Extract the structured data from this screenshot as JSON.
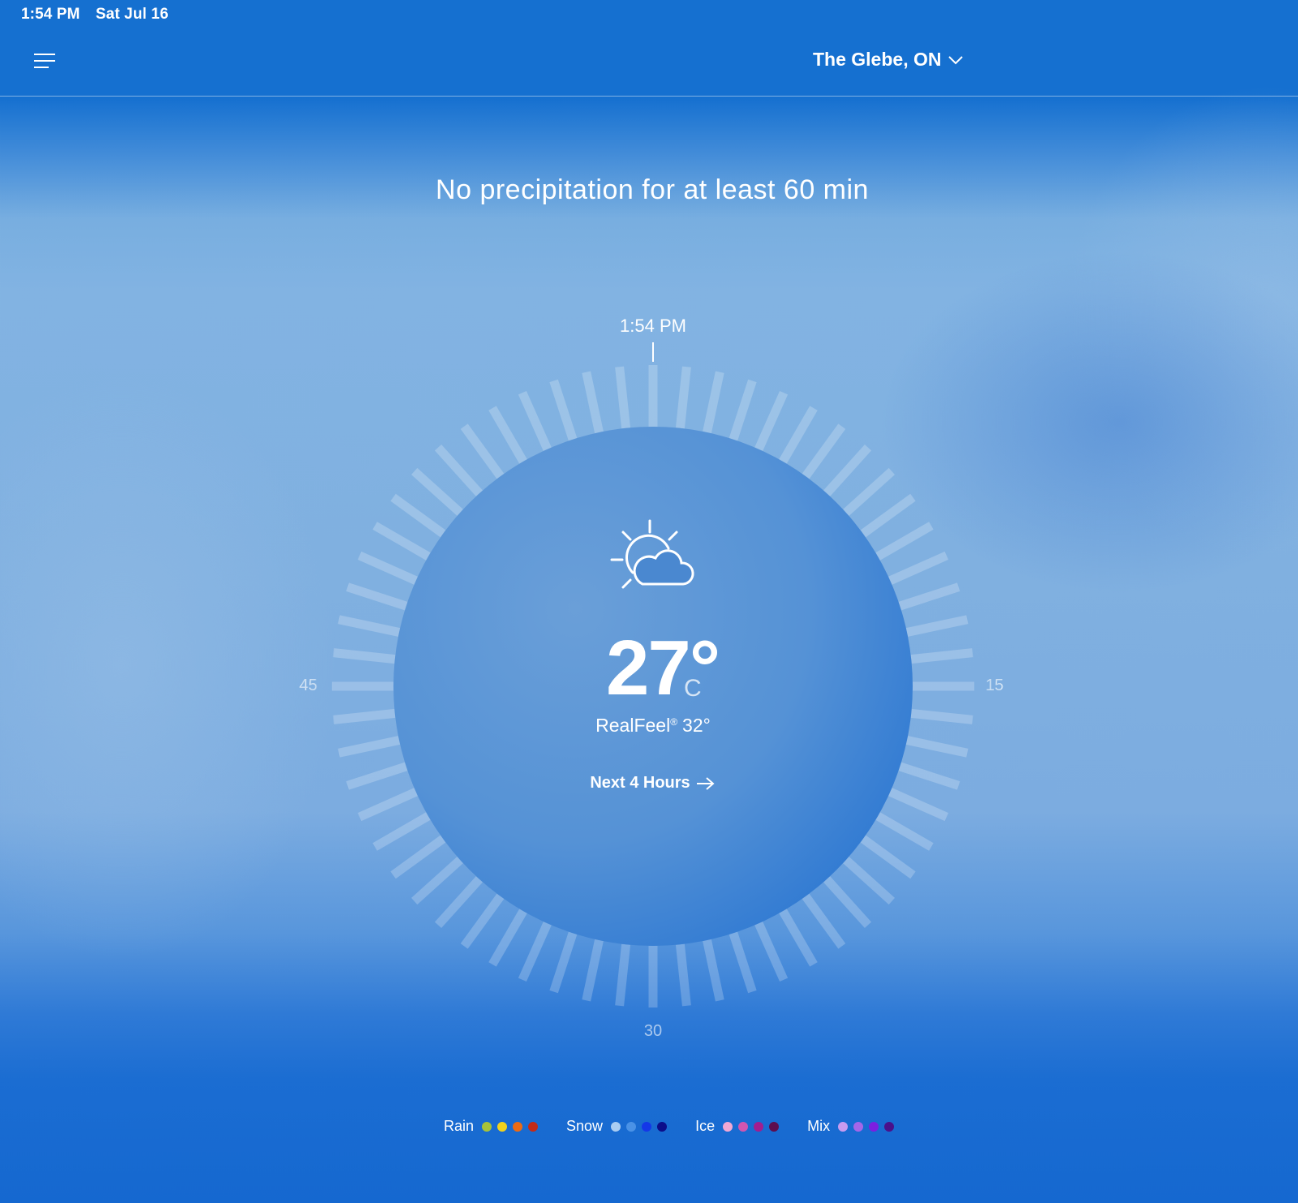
{
  "status_bar": {
    "time": "1:54 PM",
    "date": "Sat Jul 16"
  },
  "header": {
    "location": "The Glebe, ON",
    "menu_icon": "hamburger-menu-icon",
    "dropdown_icon": "chevron-down-icon"
  },
  "headline": "No precipitation for at least 60 min",
  "dial": {
    "current_time": "1:54 PM",
    "minute_labels": {
      "right": "15",
      "bottom": "30",
      "left": "45"
    }
  },
  "current": {
    "icon": "partly-sunny-icon",
    "temperature": "27°",
    "unit": "C",
    "realfeel_label": "RealFeel",
    "realfeel_mark": "®",
    "realfeel_value": "32°",
    "next_link": "Next 4 Hours"
  },
  "legend": [
    {
      "label": "Rain",
      "colors": [
        "#a7c23a",
        "#f0d21e",
        "#ec6a13",
        "#c42a17"
      ]
    },
    {
      "label": "Snow",
      "colors": [
        "#a9cdf2",
        "#4a92e6",
        "#1437e8",
        "#0c0e8a"
      ]
    },
    {
      "label": "Ice",
      "colors": [
        "#f2a8d4",
        "#d156b0",
        "#a21d8e",
        "#5e0d4e"
      ]
    },
    {
      "label": "Mix",
      "colors": [
        "#c89bf0",
        "#a566e8",
        "#7c1fe0",
        "#4a108a"
      ]
    }
  ],
  "colors": {
    "header_blue": "#1570d0",
    "dial_blue": "#4a8ad4"
  }
}
